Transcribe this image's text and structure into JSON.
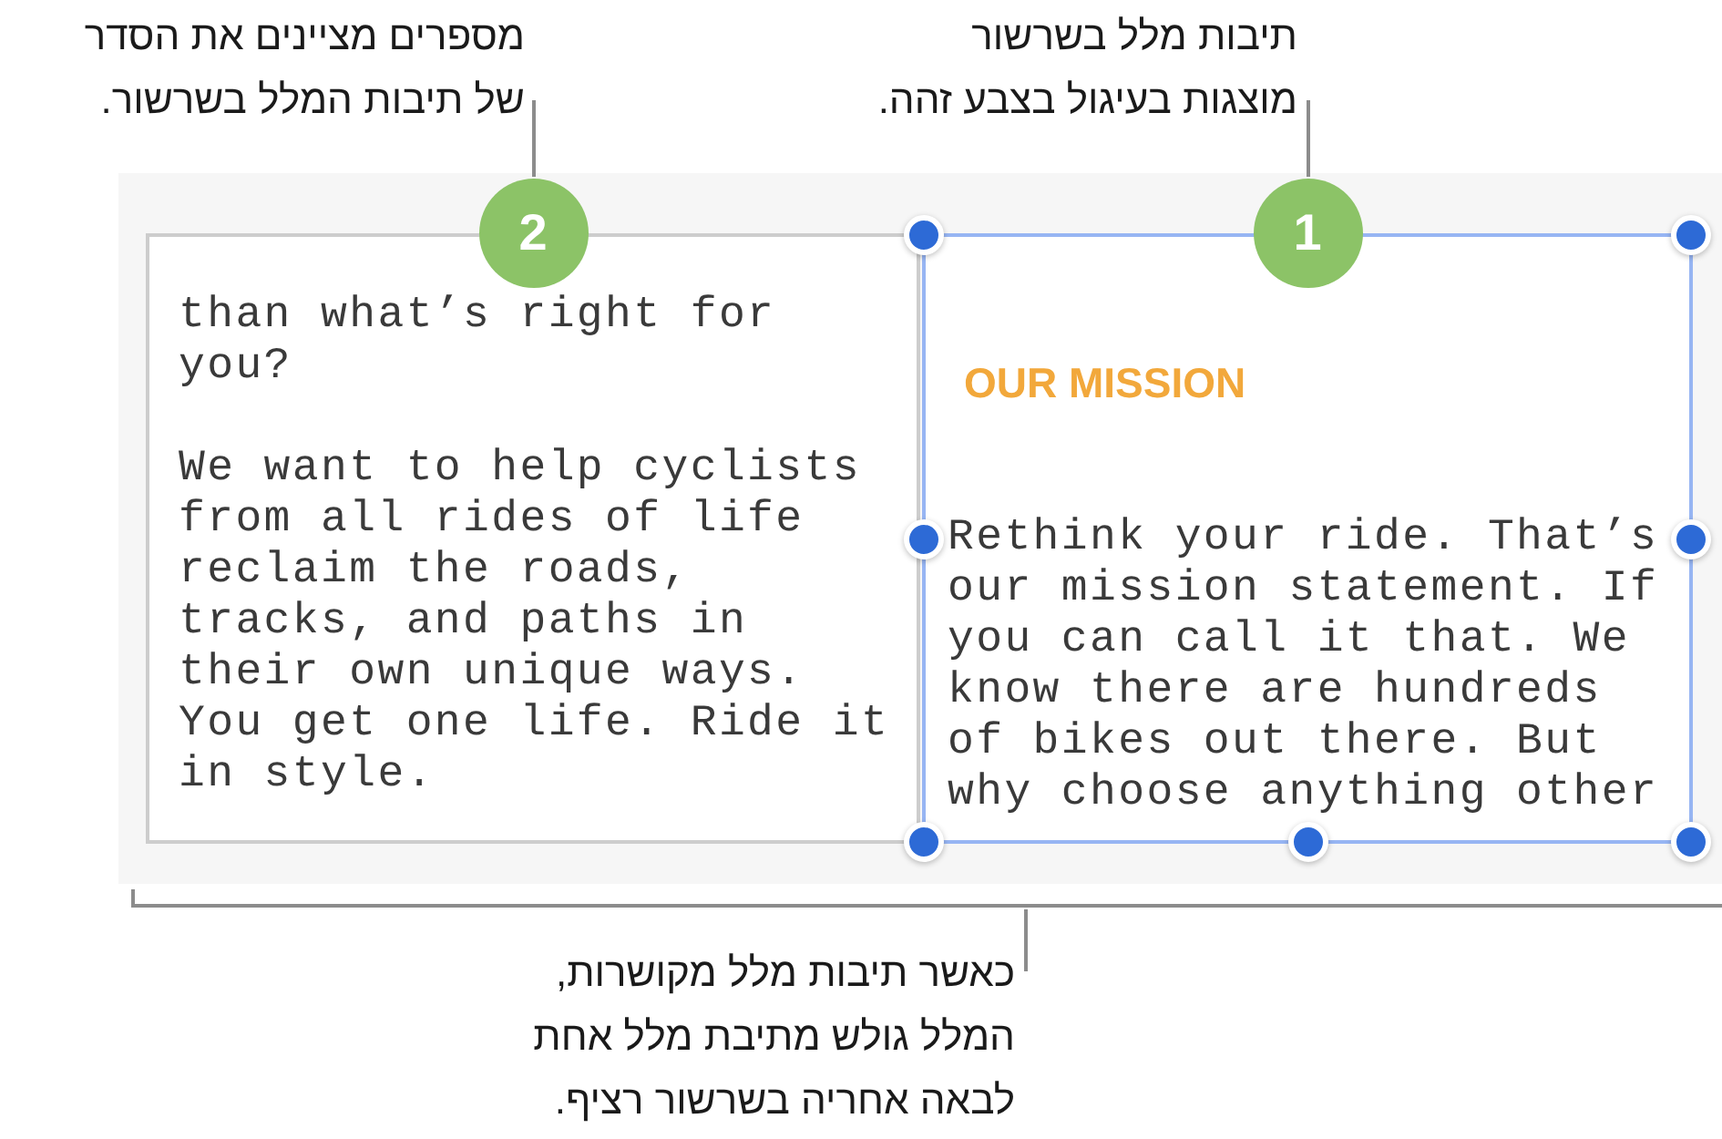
{
  "top_callouts": [
    {
      "text": "תיבות מלל בשרשור\nמוצגות בעיגול בצבע זהה."
    },
    {
      "text": "מספרים מציינים את הסדר\nשל תיבות המלל בשרשור."
    }
  ],
  "canvas": {
    "text_boxes": [
      {
        "badge": "1",
        "selected": true,
        "paragraphs": [
          {
            "kind": "heading",
            "text": "OUR MISSION"
          },
          {
            "kind": "body",
            "text": "Rethink your ride. That’s our mission statement. If you can call it that. We know there are hundreds of bikes out there. But why choose anything other"
          }
        ]
      },
      {
        "badge": "2",
        "selected": false,
        "paragraphs": [
          {
            "kind": "body",
            "text": "than what’s right for you?"
          },
          {
            "kind": "body",
            "text": "We want to help cyclists from all rides of life reclaim the roads, tracks, and paths in their own unique ways. You get one life. Ride it in style."
          }
        ]
      }
    ]
  },
  "bottom_callout": {
    "text": "כאשר תיבות מלל מקושרות,\nהמלל גולש מתיבת מלל אחת\nלבאה אחריה בשרשור רציף."
  }
}
